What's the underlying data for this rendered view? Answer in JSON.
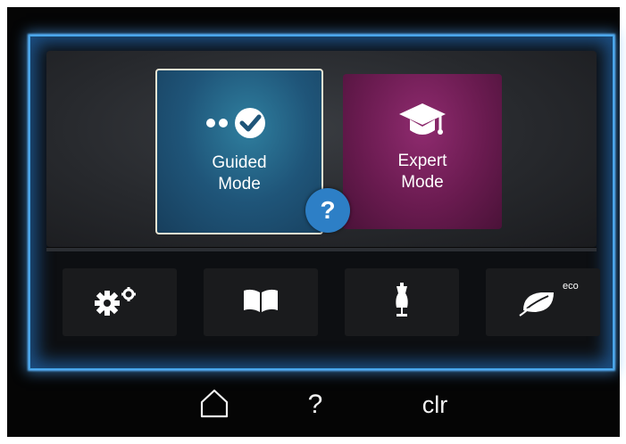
{
  "home_screen": {
    "tiles": [
      {
        "label_line1": "Guided",
        "label_line2": "Mode",
        "icon": "guided-mode-icon",
        "color": "#1f5579"
      },
      {
        "label_line1": "Expert",
        "label_line2": "Mode",
        "icon": "graduation-cap-icon",
        "color": "#6a1b50"
      }
    ],
    "help_badge": "?",
    "bottom_buttons": [
      {
        "icon": "settings-gears-icon"
      },
      {
        "icon": "tutorial-book-icon"
      },
      {
        "icon": "dress-form-icon"
      },
      {
        "icon": "eco-leaf-icon",
        "badge": "eco"
      }
    ]
  },
  "nav_bar": {
    "home_icon": "home-icon",
    "help_label": "?",
    "clear_label": "clr"
  },
  "colors": {
    "screen_glow": "#58b6ff",
    "help_circle": "#2d7fc6",
    "selected_border": "#e9e4d2"
  }
}
